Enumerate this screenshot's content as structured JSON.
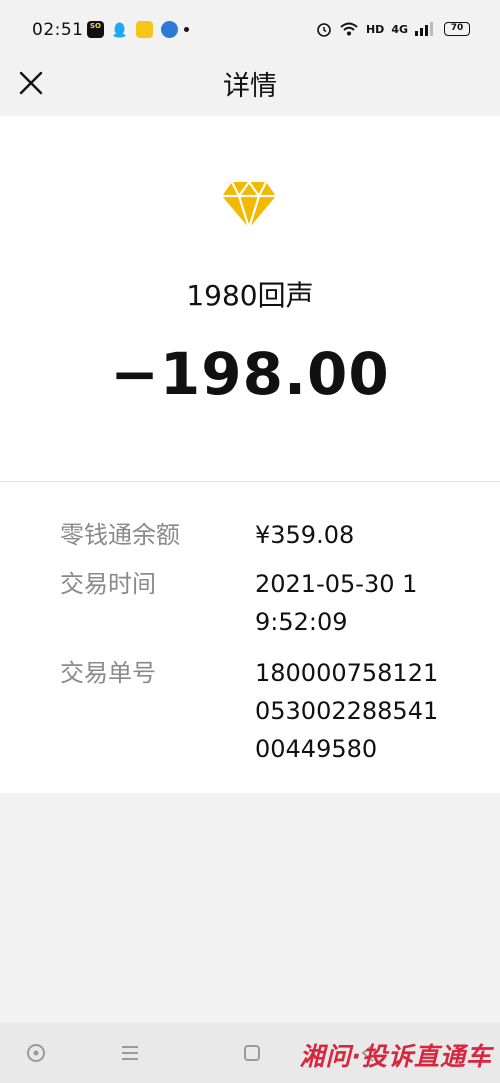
{
  "status_bar": {
    "time": "02:51",
    "so_app": "SO",
    "hd": "HD",
    "network": "4G",
    "battery": "70"
  },
  "nav": {
    "title": "详情"
  },
  "transaction": {
    "merchant": "1980回声",
    "amount": "−198.00"
  },
  "details": [
    {
      "label": "零钱通余额",
      "value": "¥359.08"
    },
    {
      "label": "交易时间",
      "value": "2021-05-30 19:52:09"
    },
    {
      "label": "交易单号",
      "value": "180000758121053002288541 00449580"
    }
  ],
  "watermark": "湘问·投诉直通车",
  "colors": {
    "gem": "#f5b800",
    "watermark": "#d7263d",
    "background": "#f2f2f2"
  }
}
